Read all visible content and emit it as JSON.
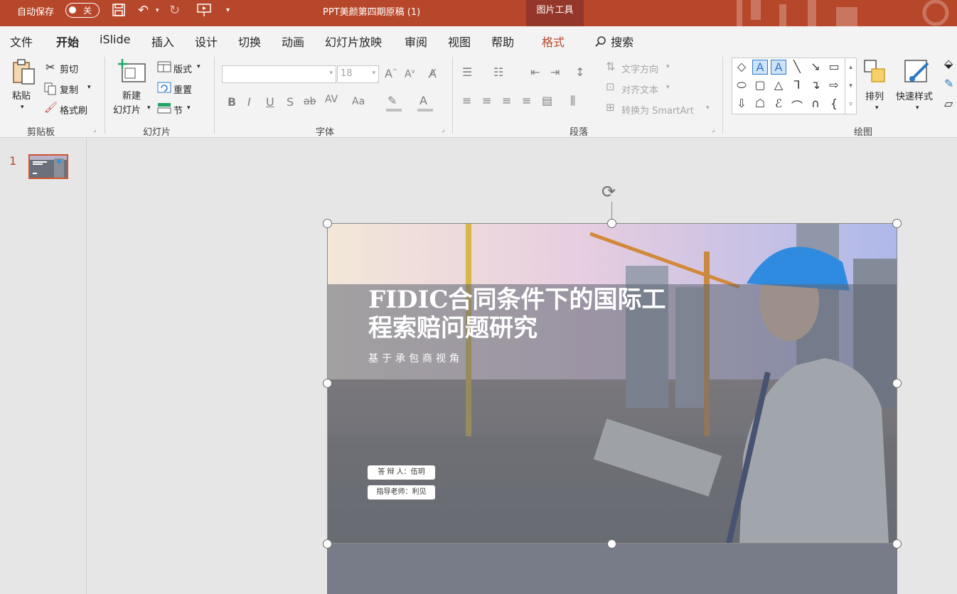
{
  "titlebar": {
    "autosave_label": "自动保存",
    "autosave_state": "关",
    "doc_title": "PPT美颜第四期原稿 (1)",
    "context_tab": "图片工具"
  },
  "tabs": {
    "items": [
      "文件",
      "开始",
      "iSlide",
      "插入",
      "设计",
      "切换",
      "动画",
      "幻灯片放映",
      "审阅",
      "视图",
      "帮助",
      "格式"
    ],
    "active": "开始",
    "search_label": "搜索"
  },
  "ribbon": {
    "clipboard": {
      "label": "剪贴板",
      "paste": "粘贴",
      "cut": "剪切",
      "copy": "复制",
      "format_painter": "格式刷"
    },
    "slides": {
      "label": "幻灯片",
      "new_slide_line1": "新建",
      "new_slide_line2": "幻灯片",
      "layout": "版式",
      "reset": "重置",
      "section": "节"
    },
    "font": {
      "label": "字体",
      "font_name": "",
      "font_size": "18",
      "bold": "B",
      "italic": "I",
      "underline": "U",
      "shadow": "S",
      "strike": "ab",
      "spacing": "AV",
      "case": "Aa",
      "grow": "A",
      "shrink": "A"
    },
    "paragraph": {
      "label": "段落",
      "text_direction": "文字方向",
      "align_text": "对齐文本",
      "convert_smartart": "转换为 SmartArt"
    },
    "drawing": {
      "label": "绘图",
      "arrange": "排列",
      "quick_styles": "快速样式"
    }
  },
  "thumbnails": {
    "slide_number": "1"
  },
  "slide": {
    "title": "FIDIC合同条件下的国际工程索赔问题研究",
    "subtitle": "基于承包商视角",
    "defender": "答 辩 人：伍玥",
    "advisor": "指导老师：利见"
  },
  "colors": {
    "accent": "#b7472a",
    "ribbon_bg": "#f3f3f3",
    "canvas_bg": "#e6e6e6",
    "slide_overlay": "#5f6673"
  }
}
